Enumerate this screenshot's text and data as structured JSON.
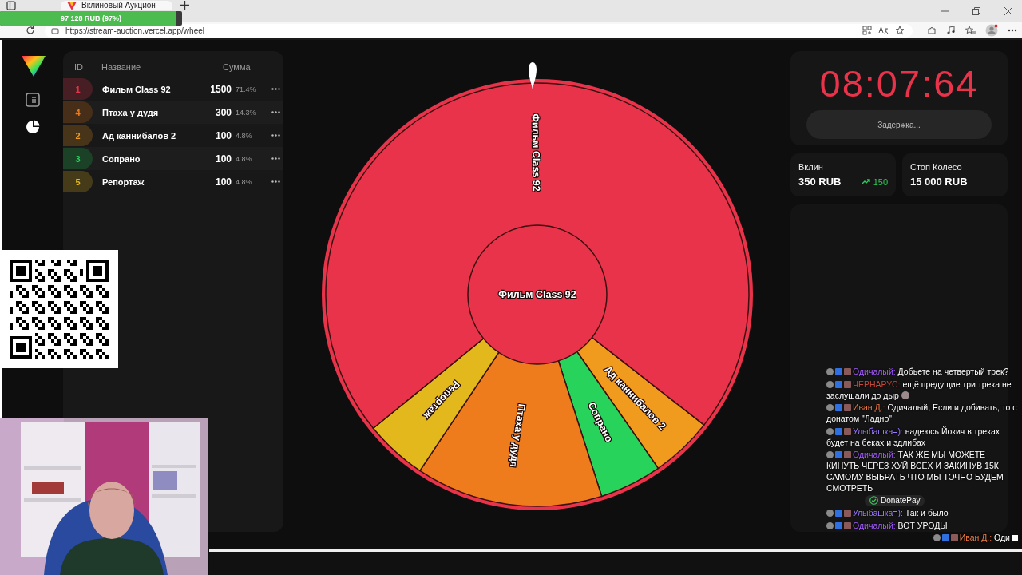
{
  "browser": {
    "tab": {
      "title": "Вклиновый Аукцион",
      "selected": true
    },
    "url": "https://stream-auction.vercel.app/wheel"
  },
  "sidebar": {
    "items": [
      {
        "kind": "list",
        "selected": false
      },
      {
        "kind": "pie",
        "selected": true
      }
    ]
  },
  "lots_table": {
    "columns": [
      "ID",
      "Название",
      "Сумма"
    ],
    "rows": [
      {
        "id": "1",
        "name": "Фильм Class 92",
        "amount": "1500",
        "percent": "71.4%",
        "color": "#e8334a"
      },
      {
        "id": "4",
        "name": "Птаха у дудя",
        "amount": "300",
        "percent": "14.3%",
        "color": "#ee7b1c"
      },
      {
        "id": "2",
        "name": "Ад каннибалов 2",
        "amount": "100",
        "percent": "4.8%",
        "color": "#f09a1e"
      },
      {
        "id": "3",
        "name": "Сопрано",
        "amount": "100",
        "percent": "4.8%",
        "color": "#27d35a"
      },
      {
        "id": "5",
        "name": "Репортаж",
        "amount": "100",
        "percent": "4.8%",
        "color": "#e3b81c"
      }
    ]
  },
  "wheel": {
    "segments": [
      {
        "label": "Ад каннибалов 2",
        "color": "#f09a1e"
      },
      {
        "label": "Сопрано",
        "color": "#27d35a"
      },
      {
        "label": "Птаха у дудя",
        "color": "#ee7b1c"
      },
      {
        "label": "Репортаж",
        "color": "#e3b81c"
      },
      {
        "label": "Фильм Class 92",
        "color": "#e8334a"
      }
    ],
    "center_label": "Фильм Class 92"
  },
  "timer": {
    "time": "08:07:64",
    "delay_button": "Задержка..."
  },
  "stats": [
    {
      "kind": "trend",
      "label": "Вклин",
      "value": "350 RUB",
      "change": "150"
    },
    {
      "kind": "plain",
      "label": "Стоп Колесо",
      "value": "15 000 RUB"
    }
  ],
  "donation_goal": {
    "text": "97 128 RUB (97%)",
    "level": 0.97
  },
  "chat": {
    "messages": [
      {
        "user": "Одичалый:",
        "color": "#a35cff",
        "text": "Добьете на четвертый трек?",
        "emote": false,
        "incoming": false
      },
      {
        "user": "ЧЕРНАРУС:",
        "color": "#c4483a",
        "text": "ещё предущие три трека не заслушали до дыр",
        "emote": true,
        "incoming": false
      },
      {
        "user": "Иван Д.:",
        "color": "#ef7b45",
        "text": "Одичалый, Если и добивать, то с донатом \"Ладно\"",
        "emote": false,
        "incoming": false
      },
      {
        "user": "Улыбашка=):",
        "color": "#9d7bff",
        "text": "надеюсь Йокич в треках будет на беках и эдлибах",
        "emote": false,
        "incoming": false
      },
      {
        "user": "Одичалый:",
        "color": "#a35cff",
        "text": "ТАК ЖЕ МЫ МОЖЕТЕ КИНУТЬ ЧЕРЕЗ ХУЙ ВСЕХ И ЗАКИНУВ 15К САМОМУ ВЫБРАТЬ ЧТО МЫ ТОЧНО БУДЕМ СМОТРЕТЬ",
        "emote": false,
        "incoming": false
      },
      {
        "user": "Улыбашка=):",
        "color": "#9d7bff",
        "text": "Так и было",
        "emote": false,
        "incoming": false
      },
      {
        "user": "Одичалый:",
        "color": "#a35cff",
        "text": "ВОТ УРОДЫ",
        "emote": false,
        "incoming": false
      },
      {
        "user": "Иван Д.:",
        "color": "#ef7b45",
        "text": "Оди",
        "emote": false,
        "incoming": true
      }
    ],
    "notification": "DonatePay"
  }
}
